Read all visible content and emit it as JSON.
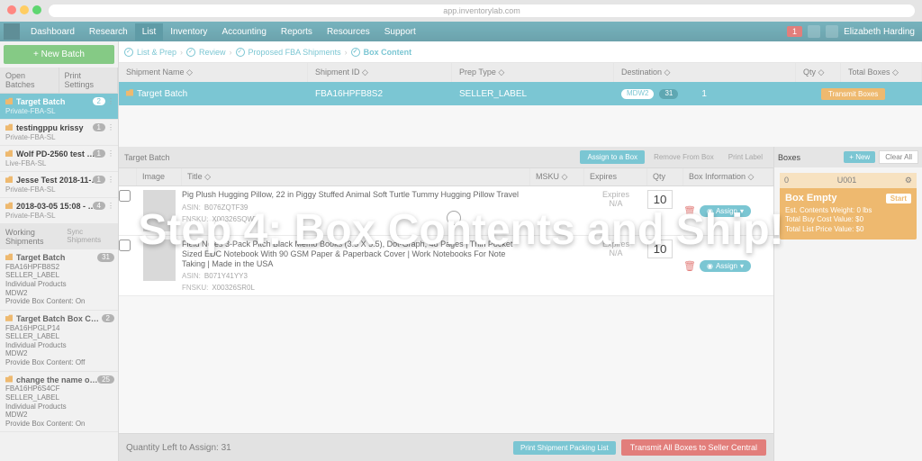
{
  "browser": {
    "url": "app.inventorylab.com"
  },
  "topnav": {
    "items": [
      "Dashboard",
      "Research",
      "List",
      "Inventory",
      "Accounting",
      "Reports",
      "Resources",
      "Support"
    ],
    "active_index": 2,
    "alert_count": "1",
    "user": "Elizabeth Harding"
  },
  "sidebar": {
    "new_batch": "+  New Batch",
    "open_label": "Open Batches",
    "print_label": "Print Settings",
    "batches": [
      {
        "name": "Target Batch",
        "sub": "Private-FBA-SL",
        "count": "2",
        "active": true
      },
      {
        "name": "testingppu krissy",
        "sub": "Private-FBA-SL",
        "count": "1"
      },
      {
        "name": "Wolf PD-2560 test …",
        "sub": "Live-FBA-SL",
        "count": "1"
      },
      {
        "name": "Jesse Test 2018-11-…",
        "sub": "Private-FBA-SL",
        "count": "1"
      },
      {
        "name": "2018-03-05 15:08 - …",
        "sub": "Private-FBA-SL",
        "count": "4"
      }
    ],
    "working_label": "Working Shipments",
    "sync_label": "Sync Shipments",
    "working": [
      {
        "name": "Target Batch",
        "count": "31",
        "lines": [
          "FBA16HPFB8S2",
          "SELLER_LABEL",
          "Individual Products",
          "MDW2",
          "Provide Box Content: On"
        ]
      },
      {
        "name": "Target Batch Box C…",
        "count": "2",
        "lines": [
          "FBA16HPGLP14",
          "SELLER_LABEL",
          "Individual Products",
          "MDW2",
          "Provide Box Content: Off"
        ]
      },
      {
        "name": "change the name o…",
        "count": "25",
        "lines": [
          "FBA16HP6S4CF",
          "SELLER_LABEL",
          "Individual Products",
          "MDW2",
          "Provide Box Content: On"
        ]
      }
    ]
  },
  "wizard": [
    "List & Prep",
    "Review",
    "Proposed FBA Shipments",
    "Box Content"
  ],
  "shipment": {
    "hdr": {
      "name": "Shipment Name ◇",
      "id": "Shipment ID ◇",
      "prep": "Prep Type ◇",
      "dest": "Destination ◇",
      "qty": "Qty ◇",
      "boxes": "Total Boxes ◇"
    },
    "row": {
      "name": "Target Batch",
      "id": "FBA16HPFB8S2",
      "prep": "SELLER_LABEL",
      "dest": "MDW2",
      "qty": "31",
      "boxes": "1",
      "transmit": "Transmit Boxes"
    }
  },
  "items": {
    "title": "Target Batch",
    "actions": {
      "assign": "Assign to a Box",
      "remove": "Remove From Box",
      "print": "Print Label"
    },
    "cols": {
      "image": "Image",
      "title": "Title ◇",
      "msku": "MSKU ◇",
      "exp": "Expires",
      "qty": "Qty",
      "box": "Box Information ◇"
    },
    "rows": [
      {
        "title": "Pig Plush Hugging Pillow, 22 in Piggy Stuffed Animal Soft Turtle Tummy Hugging Pillow Travel",
        "asin": "B076ZQTF39",
        "fnsku": "X00326SQWT",
        "qty": "10",
        "exp": "N/A"
      },
      {
        "title": "Field Notes 3-Pack Pitch Black Memo Books (3.5 X 5.5), Dot-Graph, 48 Pages | Thin Pocket Sized EDC Notebook With 90 GSM Paper & Paperback Cover | Work Notebooks For Note Taking | Made in the USA",
        "asin": "B071Y41YY3",
        "fnsku": "X00326SR0L",
        "qty": "10",
        "exp": "N/A"
      }
    ],
    "bottom_label": "Quantity Left to Assign: 31",
    "print_list": "Print Shipment Packing List",
    "transmit_all": "Transmit All Boxes to Seller Central"
  },
  "boxes": {
    "title": "Boxes",
    "new": "+ New",
    "clear": "Clear All",
    "card": {
      "id_prefix": "0",
      "id": "U001",
      "empty": "Box Empty",
      "start": "Start",
      "l1": "Est. Contents Weight: 0 lbs",
      "l2": "Total Buy Cost Value: $0",
      "l3": "Total List Price Value: $0"
    }
  },
  "overlay": {
    "h1": "Step 4: Box Contents and Ship!"
  }
}
